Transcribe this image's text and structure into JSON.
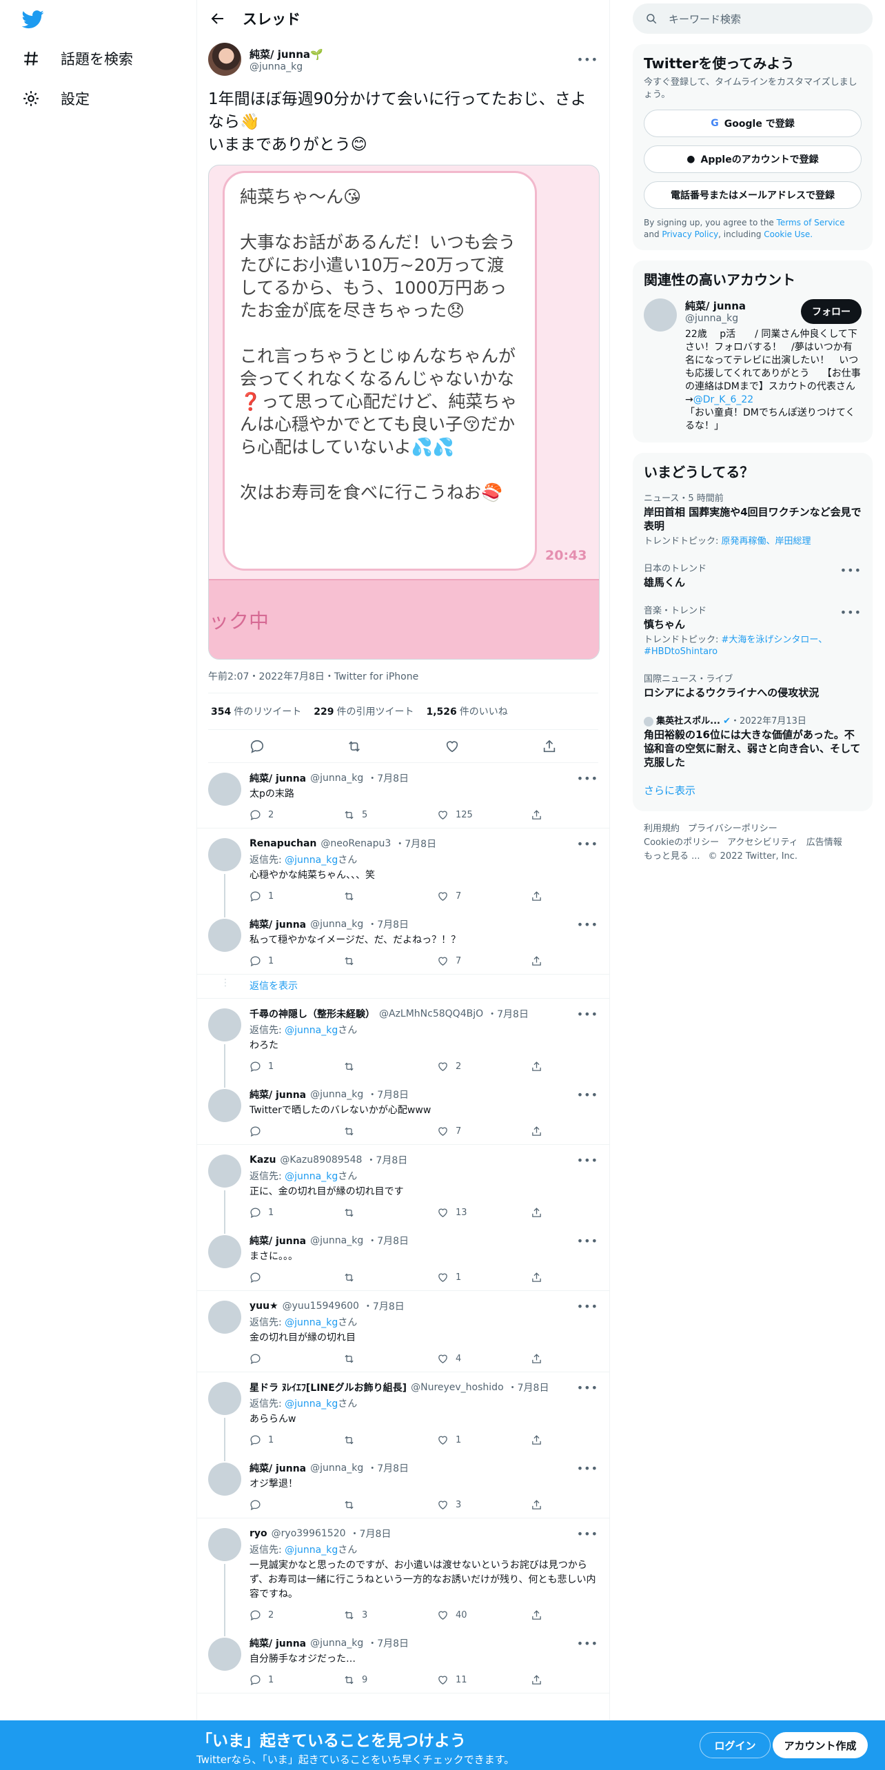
{
  "nav": {
    "explore": "話題を検索",
    "settings": "設定"
  },
  "header": {
    "title": "スレッド"
  },
  "main_tweet": {
    "name": "純菜/ junna🌱",
    "handle": "@junna_kg",
    "text_line1": "1年間ほぼ毎週90分かけて会いに行ってたおじ、さよなら👋",
    "text_line2": "いままでありがとう😊",
    "image_text": "純菜ちゃ〜ん😘\n\n大事なお話があるんだ！いつも会うたびにお小遣い10万~20万って渡してるから、もう、1000万円あったお金が底を尽きちゃった😞\n\nこれ言っちゃうとじゅんなちゃんが会ってくれなくなるんじゃないかな❓って思って心配だけど、純菜ちゃんは心穏やかでとても良い子😚だから心配はしていないよ💦💦\n\n次はお寿司を食べに行こうねお🍣",
    "image_time": "20:43",
    "image_band": "ック中",
    "meta": "午前2:07・2022年7月8日・Twitter for iPhone",
    "retweets": "354",
    "retweets_label": "件のリツイート",
    "quotes": "229",
    "quotes_label": "件の引用ツイート",
    "likes": "1,526",
    "likes_label": "件のいいね"
  },
  "replies": [
    {
      "name": "純菜/ junna",
      "handle": "@junna_kg",
      "date": "・7月8日",
      "replyto": "",
      "text": "太pの末路",
      "reply": "2",
      "rt": "5",
      "like": "125"
    },
    {
      "name": "Renapuchan",
      "handle": "@neoRenapu3",
      "date": "・7月8日",
      "replyto": "@junna_kg",
      "text": "心穏やかな純菜ちゃん、、、笑",
      "reply": "1",
      "rt": "",
      "like": "7"
    },
    {
      "name": "純菜/ junna",
      "handle": "@junna_kg",
      "date": "・7月8日",
      "replyto": "",
      "text": "私って穏やかなイメージだ、だ、だよねっ？！？",
      "reply": "1",
      "rt": "",
      "like": "7"
    },
    {
      "name": "千尋の神隠し（整形未経験）",
      "handle": "@AzLMhNc58QQ4BjO",
      "date": "・7月8日",
      "replyto": "@junna_kg",
      "text": "わろた",
      "reply": "1",
      "rt": "",
      "like": "2"
    },
    {
      "name": "純菜/ junna",
      "handle": "@junna_kg",
      "date": "・7月8日",
      "replyto": "",
      "text": "Twitterで晒したのバレないかが心配www",
      "reply": "",
      "rt": "",
      "like": "7"
    },
    {
      "name": "Kazu",
      "handle": "@Kazu89089548",
      "date": "・7月8日",
      "replyto": "@junna_kg",
      "text": "正に、金の切れ目が縁の切れ目です",
      "reply": "1",
      "rt": "",
      "like": "13"
    },
    {
      "name": "純菜/ junna",
      "handle": "@junna_kg",
      "date": "・7月8日",
      "replyto": "",
      "text": "まさに。。。",
      "reply": "",
      "rt": "",
      "like": "1"
    },
    {
      "name": "yuu★",
      "handle": "@yuu15949600",
      "date": "・7月8日",
      "replyto": "@junna_kg",
      "text": "金の切れ目が縁の切れ目",
      "reply": "",
      "rt": "",
      "like": "4"
    },
    {
      "name": "星ドラ ﾇﾚｲｴﾌ[LINEグルお飾り組長]",
      "handle": "@Nureyev_hoshido",
      "date": "・7月8日",
      "replyto": "@junna_kg",
      "text": "あららんw",
      "reply": "1",
      "rt": "",
      "like": "1"
    },
    {
      "name": "純菜/ junna",
      "handle": "@junna_kg",
      "date": "・7月8日",
      "replyto": "",
      "text": "オジ撃退！",
      "reply": "",
      "rt": "",
      "like": "3"
    },
    {
      "name": "ryo",
      "handle": "@ryo39961520",
      "date": "・7月8日",
      "replyto": "@junna_kg",
      "text": "一見誠実かなと思ったのですが、お小遣いは渡せないというお詫びは見つからず、お寿司は一緒に行こうねという一方的なお誘いだけが残り、何とも悲しい内容ですね。",
      "reply": "2",
      "rt": "3",
      "like": "40"
    },
    {
      "name": "純菜/ junna",
      "handle": "@junna_kg",
      "date": "・7月8日",
      "replyto": "",
      "text": "自分勝手なオジだった…",
      "reply": "1",
      "rt": "9",
      "like": "11"
    }
  ],
  "reply_prefix": "返信先: ",
  "reply_suffix": "さん",
  "show_replies": "返信を表示",
  "search": {
    "placeholder": "キーワード検索"
  },
  "signup_card": {
    "title": "Twitterを使ってみよう",
    "sub": "今すぐ登録して、タイムラインをカスタマイズしましょう。",
    "google": "Google で登録",
    "apple": "Appleのアカウントで登録",
    "phone": "電話番号またはメールアドレスで登録",
    "terms_a": "By signing up, you agree to the ",
    "terms_tos": "Terms of Service",
    "terms_and": " and ",
    "terms_pp": "Privacy Policy",
    "terms_inc": ", including ",
    "terms_cookie": "Cookie Use."
  },
  "related": {
    "title": "関連性の高いアカウント",
    "name": "純菜/ junna",
    "handle": "@junna_kg",
    "follow": "フォロー",
    "bio": "22歳　 p活　　/ 同業さん仲良くして下さい！フォロバする！　/夢はいつか有名になってテレビに出演したい！　いつも応援してくれてありがとう　 【お仕事の連絡はDMまで】スカウトの代表さん→",
    "bio_link": "@Dr_K_6_22",
    "bio_end": "「おい童貞！DMでちんぽ送りつけてくるな！」"
  },
  "trends": {
    "title": "いまどうしてる？",
    "items": [
      {
        "cat": "ニュース・5 時間前",
        "text": "岸田首相 国葬実施や4回目ワクチンなど会見で表明",
        "tt_label": "トレンドトピック: ",
        "tt": "原発再稼働、岸田総理"
      },
      {
        "cat": "日本のトレンド",
        "text": "雄馬くん",
        "tt_label": "",
        "tt": ""
      },
      {
        "cat": "音楽・トレンド",
        "text": "慎ちゃん",
        "tt_label": "トレンドトピック: ",
        "tt": "#大海を泳げシンタロー、#HBDtoShintaro"
      },
      {
        "cat": "国際ニュース・ライブ",
        "text": "ロシアによるウクライナへの侵攻状況",
        "tt_label": "",
        "tt": ""
      },
      {
        "cat": "集英社スポル...",
        "cat2": "・2022年7月13日",
        "text": "角田裕毅の16位には大きな価値があった。不協和音の空気に耐え、弱さと向き合い、そして克服した",
        "tt_label": "",
        "tt": ""
      }
    ],
    "more": "さらに表示"
  },
  "footer": {
    "l1": [
      "利用規約",
      "プライバシーポリシー"
    ],
    "l2": [
      "Cookieのポリシー",
      "アクセシビリティ",
      "広告情報"
    ],
    "l3": [
      "もっと見る ...",
      "© 2022 Twitter, Inc."
    ]
  },
  "bottom_bar": {
    "big": "「いま」起きていることを見つけよう",
    "small": "Twitterなら、「いま」起きていることをいち早くチェックできます。",
    "login": "ログイン",
    "signup": "アカウント作成"
  },
  "colors": {
    "accent": "#1d9bf0",
    "text": "#0f1419",
    "muted": "#536471"
  }
}
